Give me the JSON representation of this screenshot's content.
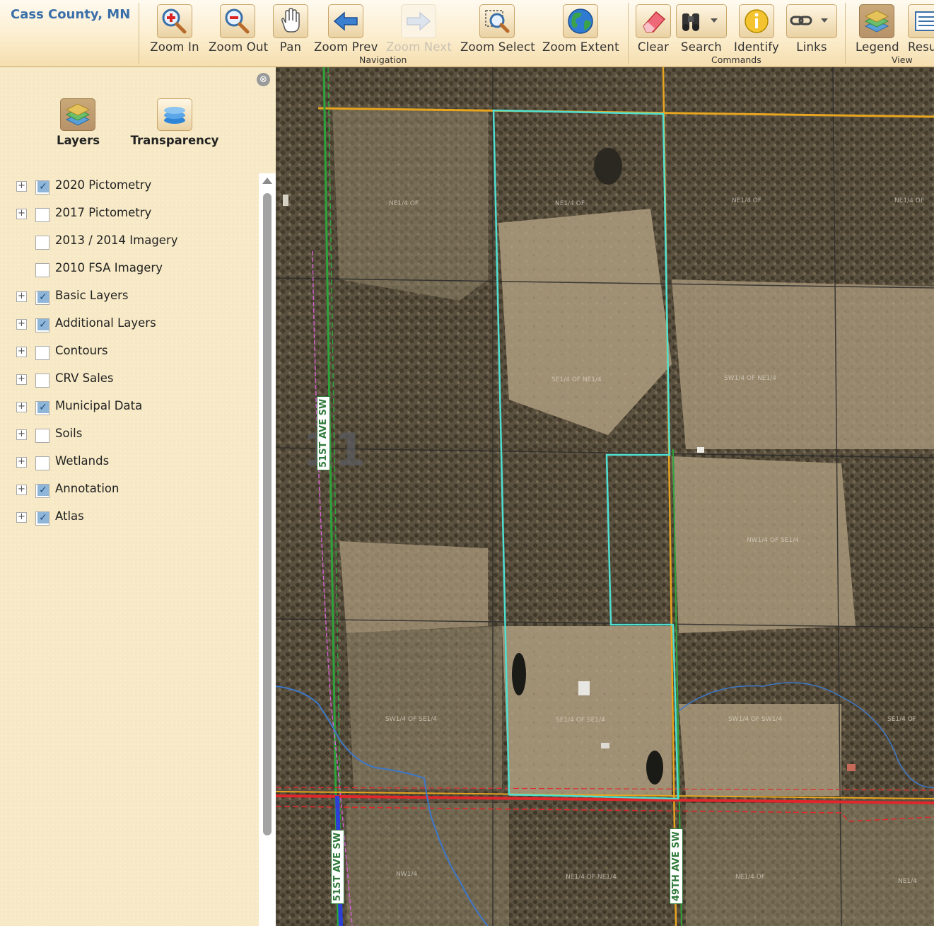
{
  "app": {
    "title": "Cass County, MN"
  },
  "toolbar": {
    "navigation": {
      "group_label": "Navigation",
      "zoom_in": "Zoom In",
      "zoom_out": "Zoom Out",
      "pan": "Pan",
      "zoom_prev": "Zoom Prev",
      "zoom_next": "Zoom Next",
      "zoom_select": "Zoom Select",
      "zoom_extent": "Zoom Extent"
    },
    "commands": {
      "group_label": "Commands",
      "clear": "Clear",
      "search": "Search",
      "identify": "Identify",
      "links": "Links"
    },
    "view": {
      "group_label": "View",
      "legend": "Legend",
      "results": "Resu"
    }
  },
  "panel": {
    "tabs": {
      "layers": "Layers",
      "transparency": "Transparency"
    },
    "close_icon": "⊗",
    "layers": [
      {
        "name": "2020 Pictometry",
        "checked": true,
        "expandable": true
      },
      {
        "name": "2017 Pictometry",
        "checked": false,
        "expandable": true
      },
      {
        "name": "2013 / 2014 Imagery",
        "checked": false,
        "expandable": false
      },
      {
        "name": "2010 FSA Imagery",
        "checked": false,
        "expandable": false
      },
      {
        "name": "Basic Layers",
        "checked": true,
        "expandable": true
      },
      {
        "name": "Additional Layers",
        "checked": true,
        "expandable": true
      },
      {
        "name": "Contours",
        "checked": false,
        "expandable": true
      },
      {
        "name": "CRV Sales",
        "checked": false,
        "expandable": true
      },
      {
        "name": "Municipal Data",
        "checked": true,
        "expandable": true
      },
      {
        "name": "Soils",
        "checked": false,
        "expandable": true
      },
      {
        "name": "Wetlands",
        "checked": false,
        "expandable": true
      },
      {
        "name": "Annotation",
        "checked": true,
        "expandable": true
      },
      {
        "name": "Atlas",
        "checked": true,
        "expandable": true
      }
    ]
  },
  "map": {
    "section_number": "11",
    "road_labels": [
      "51ST AVE SW",
      "51ST AVE SW",
      "49TH AVE SW"
    ],
    "quarter_labels": [
      "NE1/4 OF",
      "NE1/4 OF",
      "NE1/4 OF",
      "SE1/4 OF NE1/4",
      "SW1/4 OF NE1/4",
      "NW1/4 OF SE1/4",
      "NE1/4 OF",
      "SW1/4 OF SE1/4",
      "SE1/4 OF SE1/4",
      "SW1/4 OF SW1/4",
      "SE1/4 OF",
      "NW1/4",
      "NE1/4 OF NE1/4",
      "NE1/4 OF",
      "NE1/4"
    ],
    "colors": {
      "parcel_outline": "#4fe0d2",
      "section_line": "#e8a51e",
      "highway": "#e0272b",
      "road": "#2da43a",
      "water": "#3d78c9"
    }
  }
}
